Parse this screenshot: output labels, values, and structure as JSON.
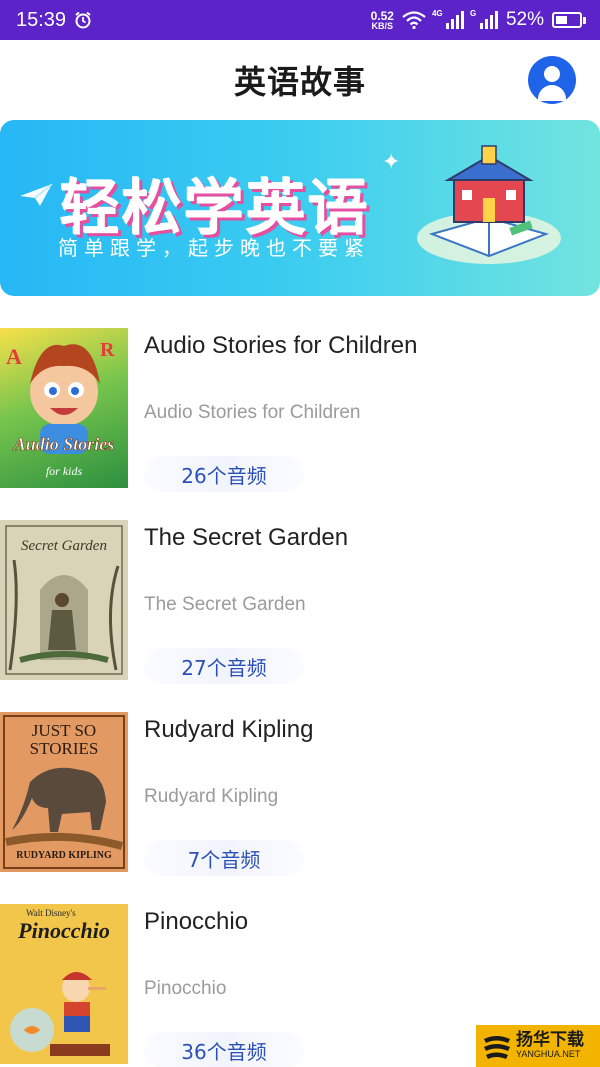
{
  "status_bar": {
    "time": "15:39",
    "net_speed_value": "0.52",
    "net_speed_unit": "KB/S",
    "signal1_tag": "4G",
    "signal2_tag": "G",
    "battery": "52%",
    "battery_level": 0.52
  },
  "header": {
    "title": "英语故事"
  },
  "banner": {
    "title": "轻松学英语",
    "subtitle": "简单跟学，起步晚也不要紧"
  },
  "stories": [
    {
      "title": "Audio Stories for Children",
      "subtitle": "Audio Stories for Children",
      "count": "26个音频",
      "cover_text": "Audio Stories",
      "cover_subtext": "for kids"
    },
    {
      "title": "The Secret Garden",
      "subtitle": "The Secret Garden",
      "count": "27个音频",
      "cover_text": "Secret Garden",
      "cover_subtext": ""
    },
    {
      "title": "Rudyard Kipling",
      "subtitle": "Rudyard Kipling",
      "count": "7个音频",
      "cover_text": "JUST SO STORIES",
      "cover_subtext": "RUDYARD KIPLING"
    },
    {
      "title": "Pinocchio",
      "subtitle": "Pinocchio",
      "count": "36个音频",
      "cover_text": "Pinocchio",
      "cover_subtext": "Walt Disney's"
    }
  ],
  "watermark": {
    "name": "扬华下载",
    "url": "YANGHUA.NET"
  }
}
